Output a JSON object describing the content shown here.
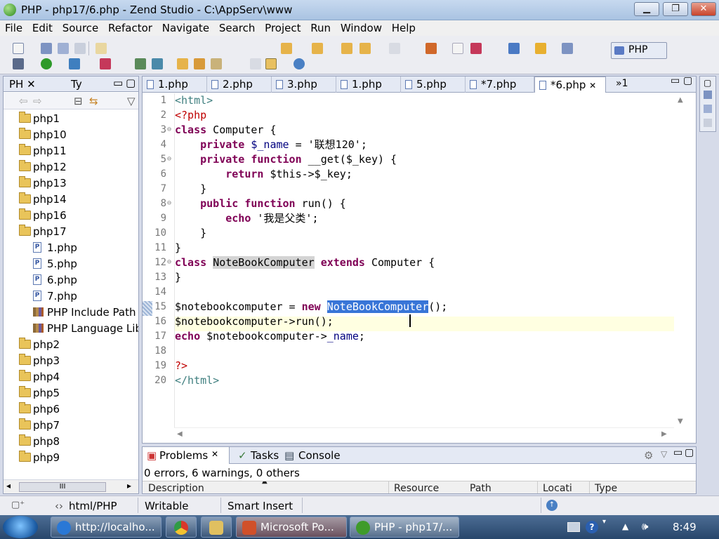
{
  "window": {
    "title": "PHP - php17/6.php - Zend Studio - C:\\AppServ\\www",
    "minimize": "▁",
    "maximize": "❐",
    "close": "✕"
  },
  "menu": [
    "File",
    "Edit",
    "Source",
    "Refactor",
    "Navigate",
    "Search",
    "Project",
    "Run",
    "Window",
    "Help"
  ],
  "perspective": {
    "label": "PHP"
  },
  "left_panel": {
    "tabs": [
      {
        "label": "PH"
      },
      {
        "label": "Ty"
      }
    ],
    "tree": [
      {
        "label": "php1",
        "type": "folder"
      },
      {
        "label": "php10",
        "type": "folder"
      },
      {
        "label": "php11",
        "type": "folder"
      },
      {
        "label": "php12",
        "type": "folder"
      },
      {
        "label": "php13",
        "type": "folder"
      },
      {
        "label": "php14",
        "type": "folder"
      },
      {
        "label": "php16",
        "type": "folder"
      },
      {
        "label": "php17",
        "type": "folder",
        "expanded": true
      },
      {
        "label": "1.php",
        "type": "file"
      },
      {
        "label": "5.php",
        "type": "file"
      },
      {
        "label": "6.php",
        "type": "file"
      },
      {
        "label": "7.php",
        "type": "file"
      },
      {
        "label": "PHP Include Path",
        "type": "lib"
      },
      {
        "label": "PHP Language Lib",
        "type": "lib"
      },
      {
        "label": "php2",
        "type": "folder"
      },
      {
        "label": "php3",
        "type": "folder"
      },
      {
        "label": "php4",
        "type": "folder"
      },
      {
        "label": "php5",
        "type": "folder"
      },
      {
        "label": "php6",
        "type": "folder"
      },
      {
        "label": "php7",
        "type": "folder"
      },
      {
        "label": "php8",
        "type": "folder"
      },
      {
        "label": "php9",
        "type": "folder"
      }
    ],
    "hscroll_thumb": "III"
  },
  "editor": {
    "tabs": [
      {
        "label": "1.php"
      },
      {
        "label": "2.php"
      },
      {
        "label": "3.php"
      },
      {
        "label": "1.php"
      },
      {
        "label": "5.php"
      },
      {
        "label": "*7.php"
      },
      {
        "label": "*6.php",
        "active": true
      }
    ],
    "overflow": "»1",
    "line_numbers": [
      "1",
      "2",
      "3",
      "4",
      "5",
      "6",
      "7",
      "8",
      "9",
      "10",
      "11",
      "12",
      "13",
      "14",
      "15",
      "16",
      "17",
      "18",
      "19",
      "20"
    ],
    "current_line": 15,
    "code_lines": [
      [
        {
          "t": "<html>",
          "c": "tag"
        }
      ],
      [
        {
          "t": "<?php",
          "c": "php"
        }
      ],
      [
        {
          "t": "class",
          "c": "kw"
        },
        {
          "t": " Computer {",
          "c": "plain"
        }
      ],
      [
        {
          "t": "    ",
          "c": "plain"
        },
        {
          "t": "private",
          "c": "kw"
        },
        {
          "t": " $_name",
          "c": "var"
        },
        {
          "t": " = ",
          "c": "plain"
        },
        {
          "t": "'联想120'",
          "c": "str"
        },
        {
          "t": ";",
          "c": "plain"
        }
      ],
      [
        {
          "t": "    ",
          "c": "plain"
        },
        {
          "t": "private function",
          "c": "kw"
        },
        {
          "t": " __get($_key) {",
          "c": "plain"
        }
      ],
      [
        {
          "t": "        ",
          "c": "plain"
        },
        {
          "t": "return",
          "c": "kw"
        },
        {
          "t": " $this->$_key;",
          "c": "plain"
        }
      ],
      [
        {
          "t": "    }",
          "c": "plain"
        }
      ],
      [
        {
          "t": "    ",
          "c": "plain"
        },
        {
          "t": "public function",
          "c": "kw"
        },
        {
          "t": " run() {",
          "c": "plain"
        }
      ],
      [
        {
          "t": "        ",
          "c": "plain"
        },
        {
          "t": "echo",
          "c": "kw"
        },
        {
          "t": " ",
          "c": "plain"
        },
        {
          "t": "'我是父类'",
          "c": "str"
        },
        {
          "t": ";",
          "c": "plain"
        }
      ],
      [
        {
          "t": "    }",
          "c": "plain"
        }
      ],
      [
        {
          "t": "}",
          "c": "plain"
        }
      ],
      [
        {
          "t": "class",
          "c": "kw"
        },
        {
          "t": " ",
          "c": "plain"
        },
        {
          "t": "NoteBookComputer",
          "c": "occ"
        },
        {
          "t": " ",
          "c": "plain"
        },
        {
          "t": "extends",
          "c": "kw"
        },
        {
          "t": " Computer {",
          "c": "plain"
        }
      ],
      [
        {
          "t": "}",
          "c": "plain"
        }
      ],
      [],
      [
        {
          "t": "$notebookcomputer = ",
          "c": "plain"
        },
        {
          "t": "new",
          "c": "kw"
        },
        {
          "t": " ",
          "c": "plain"
        },
        {
          "t": "NoteBookComputer",
          "c": "sel"
        },
        {
          "t": "();",
          "c": "plain"
        }
      ],
      [
        {
          "t": "$notebookcomputer->run();",
          "c": "plain"
        }
      ],
      [
        {
          "t": "echo",
          "c": "kw"
        },
        {
          "t": " $notebookcomputer->",
          "c": "plain"
        },
        {
          "t": "_name",
          "c": "var"
        },
        {
          "t": ";",
          "c": "plain"
        }
      ],
      [],
      [
        {
          "t": "?>",
          "c": "php"
        }
      ],
      [
        {
          "t": "</html>",
          "c": "tag"
        }
      ]
    ]
  },
  "problems": {
    "tabs": [
      {
        "label": "Problems"
      },
      {
        "label": "Tasks"
      },
      {
        "label": "Console"
      }
    ],
    "summary": "0 errors, 6 warnings, 0 others",
    "columns": [
      "Description",
      "Resource",
      "Path",
      "Locati",
      "Type"
    ]
  },
  "status": {
    "type": "html/PHP",
    "mode": "Writable",
    "insert": "Smart Insert"
  },
  "taskbar": {
    "items": [
      {
        "label": "http://localho...",
        "color": "#2a78d6"
      },
      {
        "label": "",
        "color": "#e8b030"
      },
      {
        "label": "",
        "color": "#e0c060"
      },
      {
        "label": "Microsoft Po...",
        "color": "#d0502a"
      },
      {
        "label": "PHP - php17/...",
        "color": "#3f9b2a"
      }
    ],
    "clock": "8:49"
  }
}
